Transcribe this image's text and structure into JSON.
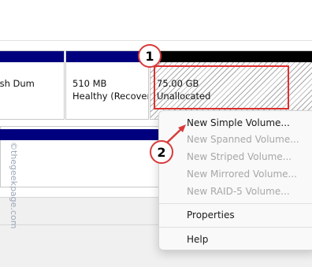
{
  "disk": {
    "partitions": [
      {
        "line1": "",
        "line2": "ile, Crash Dum"
      },
      {
        "line1": "510 MB",
        "line2": "Healthy (Recovery"
      },
      {
        "line1": "75.00 GB",
        "line2": "Unallocated"
      }
    ]
  },
  "context_menu": {
    "items": [
      {
        "label": "New Simple Volume...",
        "enabled": true
      },
      {
        "label": "New Spanned Volume...",
        "enabled": false
      },
      {
        "label": "New Striped Volume...",
        "enabled": false
      },
      {
        "label": "New Mirrored Volume...",
        "enabled": false
      },
      {
        "label": "New RAID-5 Volume...",
        "enabled": false
      },
      {
        "label": "Properties",
        "enabled": true
      },
      {
        "label": "Help",
        "enabled": true
      }
    ]
  },
  "annotations": {
    "step1": "1",
    "step2": "2"
  },
  "watermark": "©thegeekpage.com",
  "colors": {
    "partition_bar": "#00007f",
    "unallocated_bar": "#000000",
    "highlight": "#e03030",
    "badge_border": "#d83a3a"
  }
}
